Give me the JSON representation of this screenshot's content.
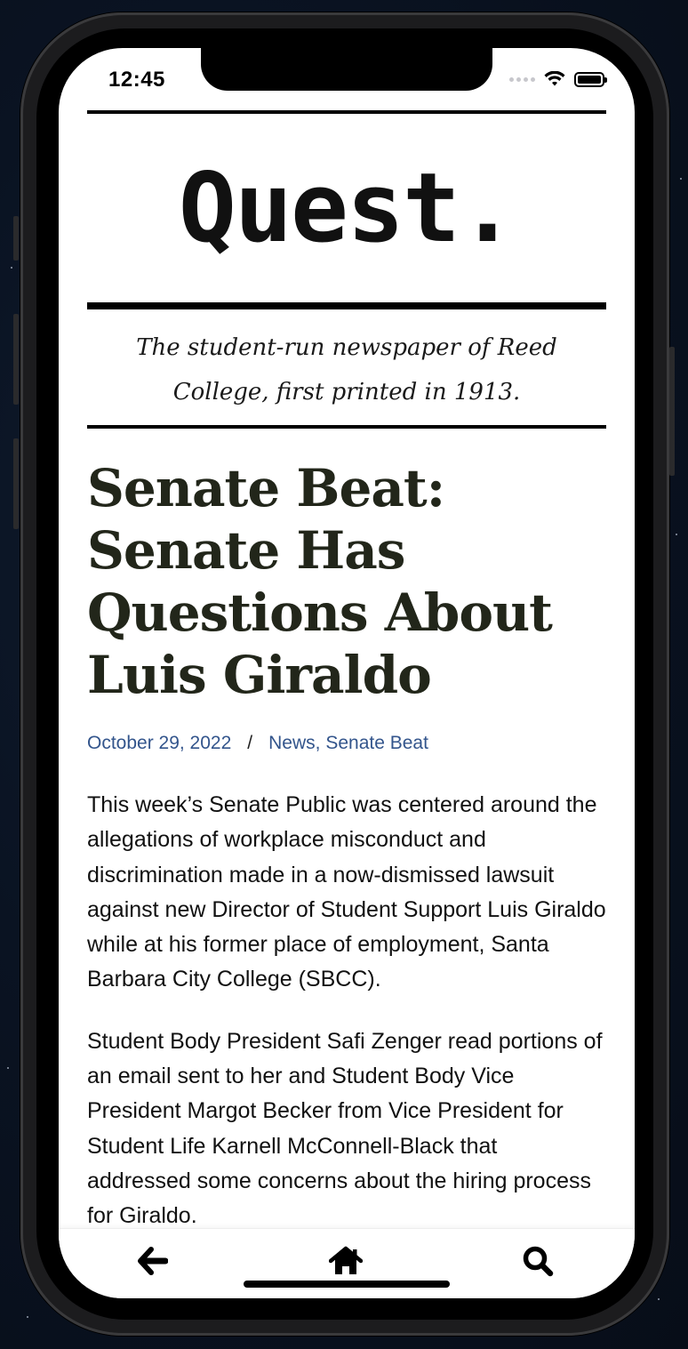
{
  "status_bar": {
    "time": "12:45"
  },
  "masthead": {
    "logo_text": "Quest."
  },
  "tagline": "The student-run newspaper of Reed College, first printed in 1913.",
  "article": {
    "title": "Senate Beat: Senate Has Questions About Luis Giraldo",
    "date": "October 29, 2022",
    "separator": "/",
    "categories": [
      "News",
      "Senate Beat"
    ],
    "paragraphs": [
      "This week’s Senate Public was centered around the allegations of workplace misconduct and discrimination made in a now-dismissed lawsuit against new Director of Student Support Luis Giraldo while at his former place of employment, Santa Barbara City College (SBCC).",
      "Student Body President Safi Zenger read portions of an email sent to her and Student Body Vice President Margot Becker from Vice President for Student Life Karnell McConnell-Black that addressed some concerns about the hiring process for Giraldo."
    ]
  },
  "tab_bar": {
    "icons": [
      "back-arrow-icon",
      "home-icon",
      "search-icon"
    ]
  },
  "colors": {
    "link": "#33558c",
    "headline": "#22261a",
    "background": "#0a1322"
  }
}
